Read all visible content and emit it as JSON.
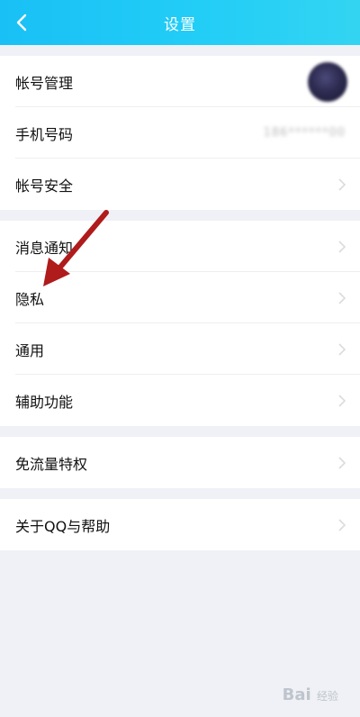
{
  "header": {
    "title": "设置",
    "back_icon": "chevron-left-icon",
    "background": "#19c0f5"
  },
  "groups": [
    {
      "items": [
        {
          "label": "帐号管理",
          "trailing": "avatar"
        },
        {
          "label": "手机号码",
          "value": "186******00",
          "trailing": "value"
        },
        {
          "label": "帐号安全",
          "trailing": "chevron"
        }
      ]
    },
    {
      "items": [
        {
          "label": "消息通知",
          "trailing": "chevron"
        },
        {
          "label": "隐私",
          "trailing": "chevron"
        },
        {
          "label": "通用",
          "trailing": "chevron"
        },
        {
          "label": "辅助功能",
          "trailing": "chevron"
        }
      ]
    },
    {
      "items": [
        {
          "label": "免流量特权",
          "trailing": "chevron"
        }
      ]
    },
    {
      "items": [
        {
          "label": "关于QQ与帮助",
          "trailing": "chevron"
        }
      ]
    }
  ],
  "annotation": {
    "arrow_color": "#b01b1b",
    "icon": "red-arrow-icon"
  },
  "watermark": {
    "text": "Bai",
    "sub": "经验"
  }
}
